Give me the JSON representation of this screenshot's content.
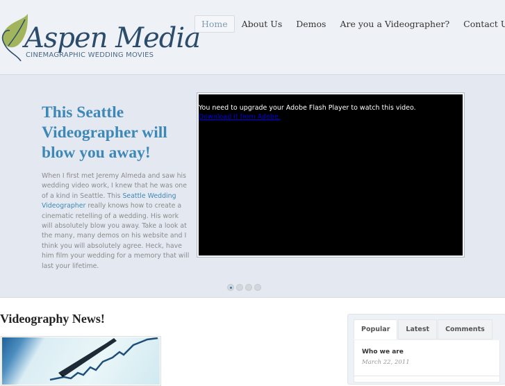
{
  "header": {
    "logo_text": "Aspen Media",
    "logo_tagline": "CINEMAGRAPHIC WEDDING MOVIES",
    "nav": [
      {
        "label": "Home",
        "active": true
      },
      {
        "label": "About Us",
        "active": false
      },
      {
        "label": "Demos",
        "active": false
      },
      {
        "label": "Are you a Videographer?",
        "active": false
      },
      {
        "label": "Contact Us",
        "active": false
      }
    ]
  },
  "hero": {
    "title": "This Seattle Videographer will blow you away!",
    "text_before_link": "When I first met Jeremy Almeda and saw his wedding video work, I knew that he was one of a kind in Seattle.  This ",
    "link_text": "Seattle Wedding Videographer",
    "text_after_link": " really knows how to create a cinematic retelling of a wedding.  His work will absolutely blow you away.  Take a look at the many, many demos on his website and I think you will absolutely agree.  Heck, have him film your wedding for a memory that will last your lifetime.",
    "video": {
      "message": "You need to upgrade your Adobe Flash Player to watch this video.",
      "link": "Download it from Adobe."
    },
    "slides": {
      "count": 4,
      "active_index": 0
    }
  },
  "news": {
    "title": "Videography News!",
    "image_alt": "financial chart with pen"
  },
  "sidebar": {
    "tabs": [
      {
        "label": "Popular",
        "active": true
      },
      {
        "label": "Latest",
        "active": false
      },
      {
        "label": "Comments",
        "active": false
      }
    ],
    "posts": [
      {
        "title": "Who we are",
        "date": "March 22, 2011"
      }
    ]
  },
  "colors": {
    "accent": "#3d88b7",
    "header_bg": "#eef1f6",
    "hero_bg": "#e4e9f1",
    "logo_leaf": "#a3b55c",
    "logo_text": "#2c4c6c"
  }
}
